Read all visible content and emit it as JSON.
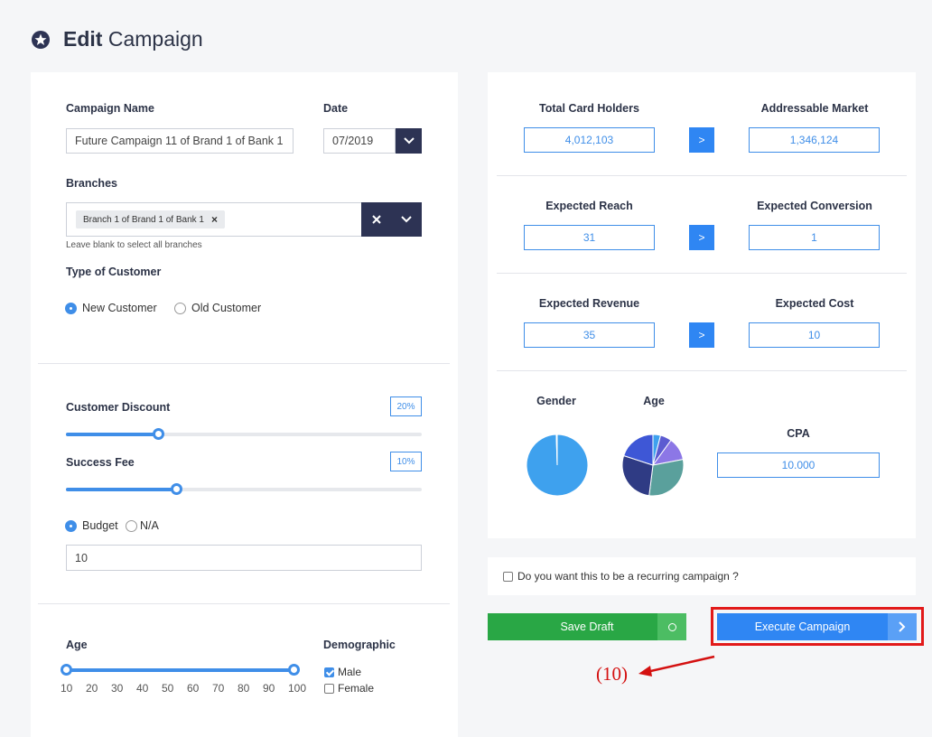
{
  "page": {
    "title_bold": "Edit",
    "title_rest": " Campaign"
  },
  "form": {
    "campaign_name": {
      "label": "Campaign Name",
      "value": "Future Campaign 11 of Brand 1 of Bank 1"
    },
    "date": {
      "label": "Date",
      "value": "07/2019"
    },
    "branches": {
      "label": "Branches",
      "chip": "Branch 1 of Brand 1 of Bank 1",
      "hint": "Leave blank to select all branches"
    },
    "customer_type": {
      "label": "Type of Customer",
      "options": [
        "New Customer",
        "Old Customer"
      ],
      "selected": "New Customer"
    },
    "discount": {
      "label": "Customer Discount",
      "value_label": "20%",
      "level": 0.26
    },
    "success_fee": {
      "label": "Success Fee",
      "value_label": "10%",
      "level": 0.31
    },
    "budget": {
      "options": [
        "Budget",
        "N/A"
      ],
      "selected": "Budget",
      "value": "10"
    },
    "age": {
      "label": "Age",
      "ticks": [
        "10",
        "20",
        "30",
        "40",
        "50",
        "60",
        "70",
        "80",
        "90",
        "100"
      ],
      "min": 10,
      "max": 100
    },
    "demographic": {
      "label": "Demographic",
      "options": [
        {
          "label": "Male",
          "checked": true
        },
        {
          "label": "Female",
          "checked": false
        }
      ]
    }
  },
  "metrics": {
    "total_card_holders": {
      "label": "Total Card Holders",
      "value": "4,012,103"
    },
    "addressable_market": {
      "label": "Addressable Market",
      "value": "1,346,124"
    },
    "expected_reach": {
      "label": "Expected Reach",
      "value": "31"
    },
    "expected_conversion": {
      "label": "Expected Conversion",
      "value": "1"
    },
    "expected_revenue": {
      "label": "Expected Revenue",
      "value": "35"
    },
    "expected_cost": {
      "label": "Expected Cost",
      "value": "10"
    },
    "arrow": ">",
    "gender_label": "Gender",
    "age_label": "Age",
    "cpa": {
      "label": "CPA",
      "value": "10.000"
    }
  },
  "gender_chart": {
    "colors": [
      "#3ea1ee",
      "#ffffff"
    ],
    "shares": [
      0.995,
      0.005
    ]
  },
  "age_chart": {
    "colors": [
      "#3ea1ee",
      "#5c5bd1",
      "#8c77e6",
      "#5aa09c",
      "#2f3b84",
      "#3e57d6"
    ],
    "shares": [
      0.04,
      0.06,
      0.12,
      0.3,
      0.28,
      0.2
    ]
  },
  "recurring": {
    "label": "Do you want this to be a recurring campaign ?",
    "checked": false
  },
  "actions": {
    "save_draft": "Save Draft",
    "execute": "Execute Campaign"
  },
  "annotation": {
    "text": "(10)",
    "color": "#d41111"
  }
}
